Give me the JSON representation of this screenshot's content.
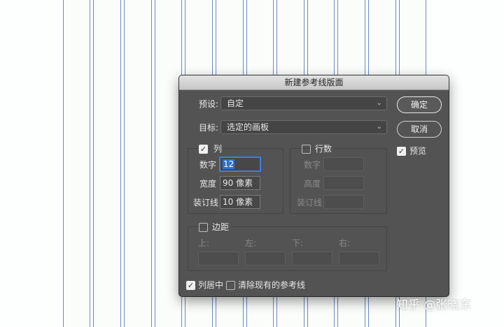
{
  "dialog": {
    "title": "新建参考线版面",
    "preset_label": "预设:",
    "preset_value": "自定",
    "target_label": "目标:",
    "target_value": "选定的画板",
    "ok_label": "确定",
    "cancel_label": "取消",
    "preview_label": "预览",
    "preview_checked": true,
    "columns": {
      "label": "列",
      "checked": true,
      "number_label": "数字",
      "number_value": "12",
      "width_label": "宽度",
      "width_value": "90 像素",
      "gutter_label": "装订线",
      "gutter_value": "10 像素"
    },
    "rows": {
      "label": "行数",
      "checked": false,
      "number_label": "数字",
      "height_label": "高度",
      "gutter_label": "装订线"
    },
    "margin": {
      "label": "边距",
      "checked": false,
      "top_label": "上:",
      "left_label": "左:",
      "bottom_label": "下:",
      "right_label": "右:"
    },
    "center_columns_label": "列居中",
    "center_columns_checked": true,
    "clear_guides_label": "清除现有的参考线",
    "clear_guides_checked": false
  },
  "watermark": "知乎 @张晓东",
  "colors": {
    "guide": "#6c89c9",
    "dialog_bg": "#535353",
    "focus": "#3f7fd8"
  }
}
